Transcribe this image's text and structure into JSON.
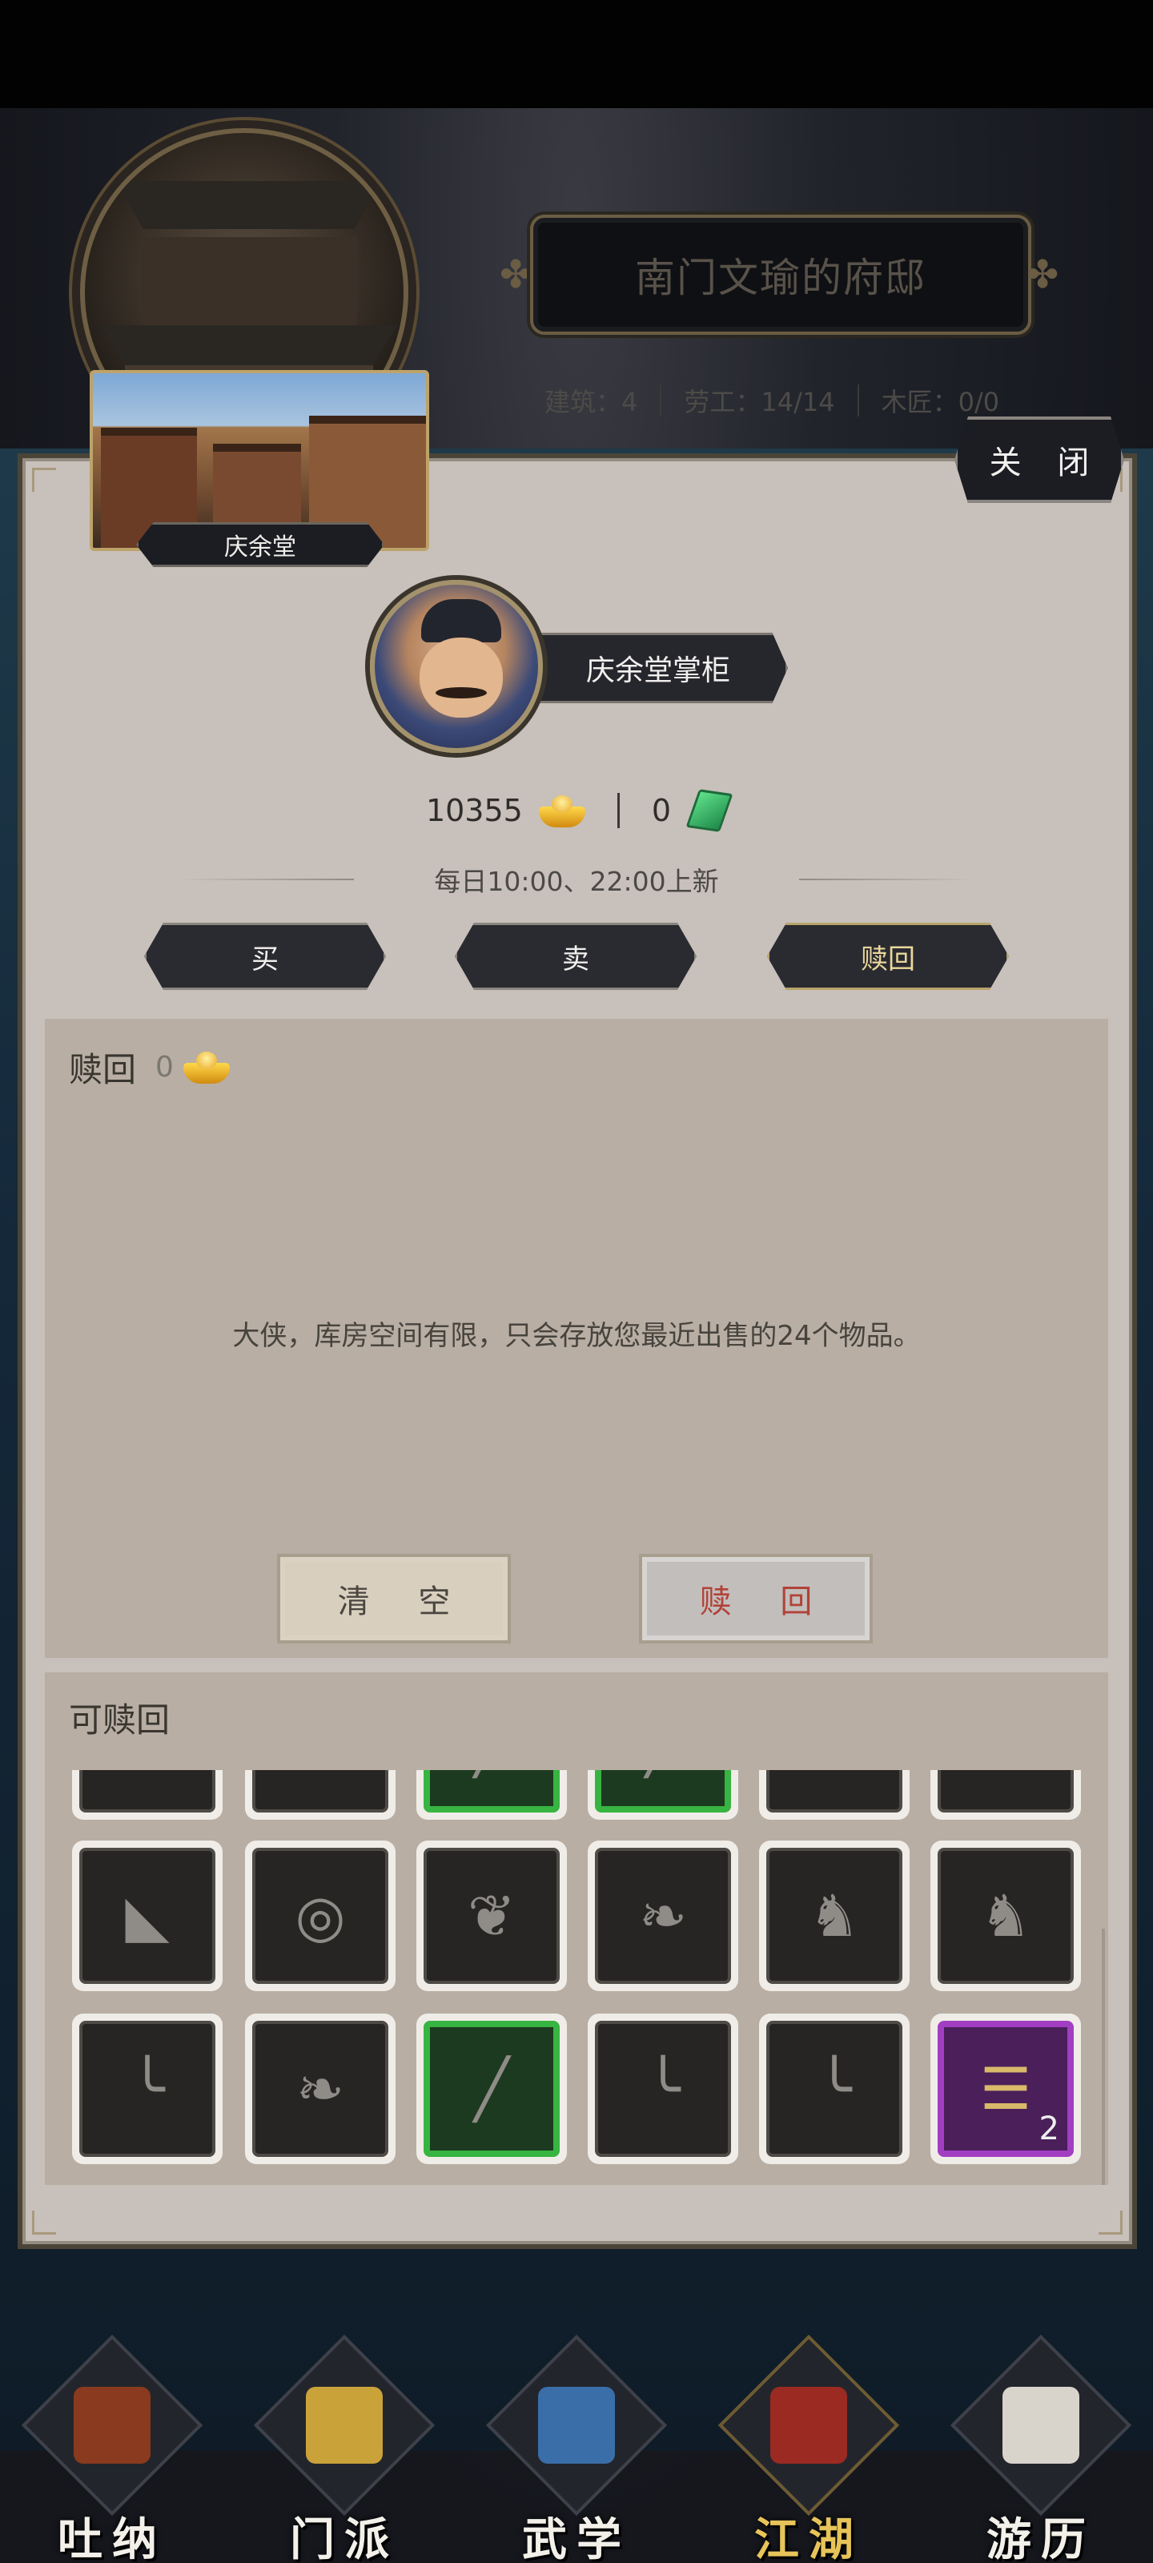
{
  "residence": {
    "title": "南门文瑜的府邸",
    "stats": [
      {
        "label": "建筑：4"
      },
      {
        "label": "劳工：14/14"
      },
      {
        "label": "木匠：0/0"
      }
    ]
  },
  "close_label": "关 闭",
  "shop": {
    "name": "庆余堂",
    "keeper_name": "庆余堂掌柜"
  },
  "currency": {
    "gold": "10355",
    "jade": "0"
  },
  "refresh_text": "每日10:00、22:00上新",
  "tabs": [
    {
      "label": "买"
    },
    {
      "label": "卖"
    },
    {
      "label": "赎回"
    }
  ],
  "redeem": {
    "title": "赎回",
    "cost": "0",
    "message": "大侠，库房空间有限，只会存放您最近出售的24个物品。",
    "clear_label": "清 空",
    "redeem_label": "赎 回"
  },
  "items_section": {
    "title": "可赎回",
    "rows": [
      [
        {
          "icon": "belt-icon",
          "rarity": "common"
        },
        {
          "icon": "robe-icon",
          "rarity": "common"
        },
        {
          "icon": "spear-icon",
          "rarity": "green"
        },
        {
          "icon": "spear-icon",
          "rarity": "green"
        },
        {
          "icon": "belt-icon",
          "rarity": "common"
        },
        {
          "icon": "armor-icon",
          "rarity": "common"
        }
      ],
      [
        {
          "icon": "bracer-icon",
          "rarity": "common"
        },
        {
          "icon": "bead-bracelet-icon",
          "rarity": "common"
        },
        {
          "icon": "robe-icon",
          "rarity": "common"
        },
        {
          "icon": "belt-icon",
          "rarity": "common"
        },
        {
          "icon": "boots-icon",
          "rarity": "common"
        },
        {
          "icon": "boots-icon",
          "rarity": "common"
        }
      ],
      [
        {
          "icon": "saber-icon",
          "rarity": "common"
        },
        {
          "icon": "belt-icon",
          "rarity": "common"
        },
        {
          "icon": "spear-icon",
          "rarity": "green"
        },
        {
          "icon": "saber-icon",
          "rarity": "common"
        },
        {
          "icon": "saber-icon",
          "rarity": "common"
        },
        {
          "icon": "scroll-icon",
          "rarity": "purple",
          "quantity": "2"
        }
      ]
    ]
  },
  "bottom_nav": [
    {
      "label": "吐纳",
      "icon": "meditation-icon"
    },
    {
      "label": "门派",
      "icon": "sect-banner-icon"
    },
    {
      "label": "武学",
      "icon": "martial-book-icon"
    },
    {
      "label": "江湖",
      "icon": "bamboo-hat-icon",
      "active": true
    },
    {
      "label": "游历",
      "icon": "horse-icon"
    }
  ],
  "colors": {
    "accent_gold": "#e7c45a",
    "rarity_green": "#37b441",
    "rarity_purple": "#a23ec2",
    "redeem_red": "#b24238"
  }
}
